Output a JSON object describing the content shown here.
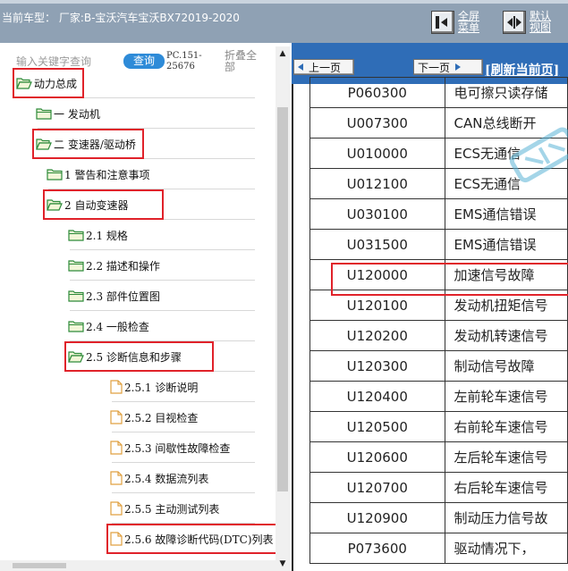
{
  "header": {
    "car_info": "当前车型：  厂家:B-宝沃汽车宝沃BX72019-2020",
    "fullscreen_label": "全屏菜单",
    "default_view_label": "默认视图"
  },
  "search": {
    "placeholder": "输入关键字查询",
    "query_label": "查询",
    "pc_code": "PC.151-25676",
    "collapse_label": "折叠全部"
  },
  "tree": [
    {
      "label": "动力总成",
      "icon": "folder-open-icon",
      "highlighted": true
    },
    {
      "label": "一 发动机",
      "icon": "folder-icon",
      "highlighted": false
    },
    {
      "label": "二 变速器/驱动桥",
      "icon": "folder-open-icon",
      "highlighted": true
    },
    {
      "label": "1 警告和注意事项",
      "icon": "folder-icon",
      "highlighted": false
    },
    {
      "label": "2 自动变速器",
      "icon": "folder-open-icon",
      "highlighted": true
    },
    {
      "label": "2.1 规格",
      "icon": "folder-icon",
      "highlighted": false
    },
    {
      "label": "2.2 描述和操作",
      "icon": "folder-icon",
      "highlighted": false
    },
    {
      "label": "2.3 部件位置图",
      "icon": "folder-icon",
      "highlighted": false
    },
    {
      "label": "2.4 一般检查",
      "icon": "folder-icon",
      "highlighted": false
    },
    {
      "label": "2.5 诊断信息和步骤",
      "icon": "folder-open-icon",
      "highlighted": true
    },
    {
      "label": "2.5.1 诊断说明",
      "icon": "file-icon",
      "highlighted": false
    },
    {
      "label": "2.5.2 目视检查",
      "icon": "file-icon",
      "highlighted": false
    },
    {
      "label": "2.5.3 间歇性故障检查",
      "icon": "file-icon",
      "highlighted": false
    },
    {
      "label": "2.5.4 数据流列表",
      "icon": "file-icon",
      "highlighted": false
    },
    {
      "label": "2.5.5 主动测试列表",
      "icon": "file-icon",
      "highlighted": false
    },
    {
      "label": "2.5.6 故障诊断代码(DTC)列表",
      "icon": "file-icon",
      "highlighted": true
    }
  ],
  "content_nav": {
    "prev_label": "上一页",
    "next_label": "下一页",
    "refresh_label": "[刷新当前页]"
  },
  "dtc_rows": [
    {
      "code": "P060300",
      "desc": "电可擦只读存储"
    },
    {
      "code": "U007300",
      "desc": "CAN总线断开"
    },
    {
      "code": "U010000",
      "desc": "ECS无通信"
    },
    {
      "code": "U012100",
      "desc": "ECS无通信"
    },
    {
      "code": "U030100",
      "desc": "EMS通信错误"
    },
    {
      "code": "U031500",
      "desc": "EMS通信错误"
    },
    {
      "code": "U120000",
      "desc": "加速信号故障",
      "highlighted": true
    },
    {
      "code": "U120100",
      "desc": "发动机扭矩信号"
    },
    {
      "code": "U120200",
      "desc": "发动机转速信号"
    },
    {
      "code": "U120300",
      "desc": "制动信号故障"
    },
    {
      "code": "U120400",
      "desc": "左前轮车速信号"
    },
    {
      "code": "U120500",
      "desc": "右前轮车速信号"
    },
    {
      "code": "U120600",
      "desc": "左后轮车速信号"
    },
    {
      "code": "U120700",
      "desc": "右后轮车速信号"
    },
    {
      "code": "U120900",
      "desc": "制动压力信号故"
    },
    {
      "code": "P073600",
      "desc": "驱动情况下，"
    }
  ],
  "colors": {
    "highlight": "#e0222a",
    "top_bar": "#8fa1b4",
    "right_bar": "#2f6db7",
    "query_button": "#2e8bd8"
  }
}
